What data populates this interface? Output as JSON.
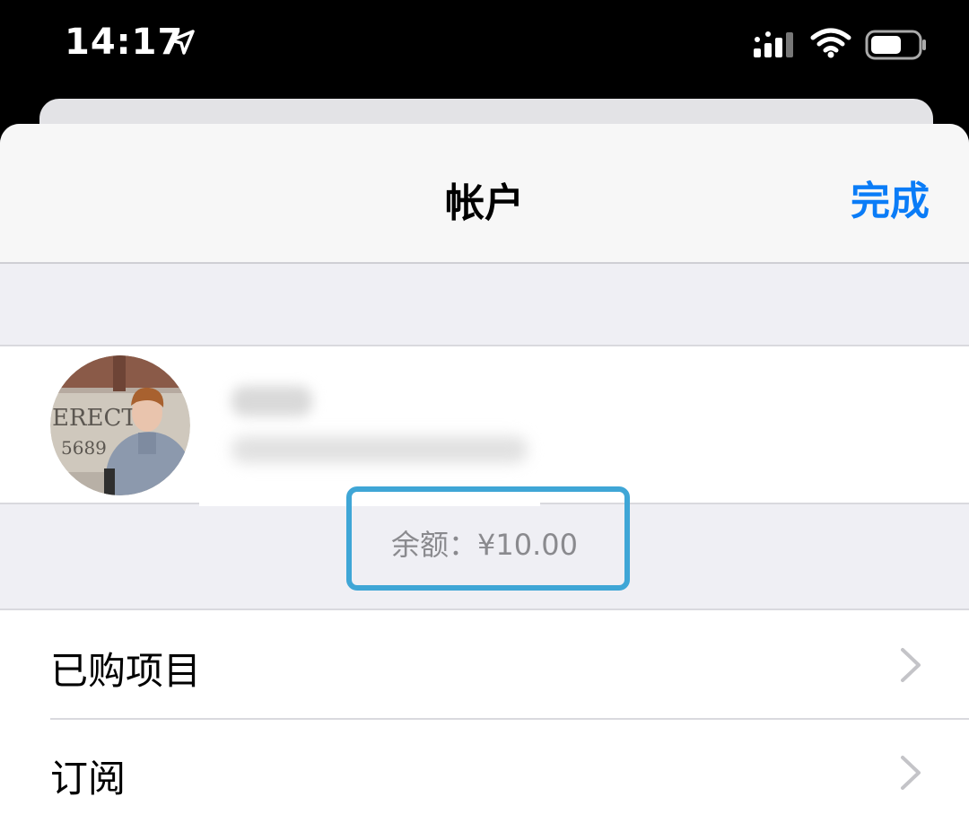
{
  "status_bar": {
    "time": "14:17",
    "icons": [
      "location-arrow-icon",
      "cellular-signal-icon",
      "wifi-icon",
      "battery-icon"
    ]
  },
  "nav": {
    "title": "帐户",
    "done_label": "完成"
  },
  "profile": {
    "avatar_text_line1": "ERECTE",
    "avatar_text_line2": "5689"
  },
  "balance": {
    "text": "余额：¥10.00"
  },
  "list": {
    "items": [
      {
        "label": "已购项目"
      },
      {
        "label": "订阅"
      }
    ]
  },
  "colors": {
    "accent": "#0a7cf7",
    "highlight_border": "#3fa6d6",
    "grouped_background": "#efeff4"
  }
}
